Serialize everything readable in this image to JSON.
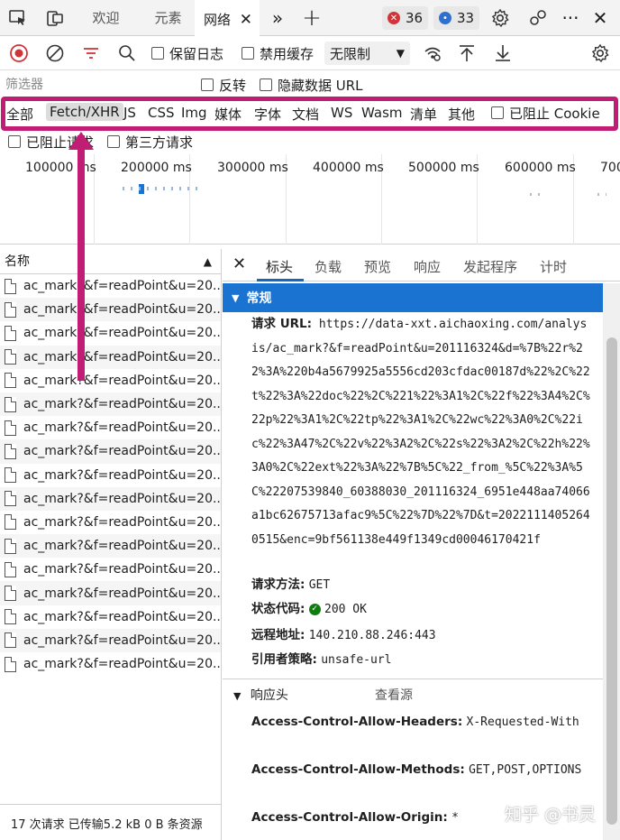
{
  "tabs": [
    {
      "label": "欢迎"
    },
    {
      "label": "元素"
    },
    {
      "label": "网络"
    }
  ],
  "badges": {
    "errors": "36",
    "messages": "33"
  },
  "toolbar": {
    "preserve_log": "保留日志",
    "disable_cache": "禁用缓存",
    "throttle": "无限制"
  },
  "filter": {
    "placeholder": "筛选器",
    "invert": "反转",
    "hide_data_url": "隐藏数据 URL"
  },
  "types": [
    "全部",
    "Fetch/XHR",
    "JS",
    "CSS",
    "Img",
    "媒体",
    "字体",
    "文档",
    "WS",
    "Wasm",
    "清单",
    "其他"
  ],
  "blocked_cookies": "已阻止 Cookie",
  "blocked_requests": "已阻止请求",
  "third_party": "第三方请求",
  "timeline_ticks": [
    "100000 ms",
    "200000 ms",
    "300000 ms",
    "400000 ms",
    "500000 ms",
    "600000 ms",
    "700"
  ],
  "list": {
    "header": "名称",
    "rows": [
      "ac_mark?&f=readPoint&u=20...",
      "ac_mark?&f=readPoint&u=20...",
      "ac_mark?&f=readPoint&u=20...",
      "ac_mark?&f=readPoint&u=20...",
      "ac_mark?&f=readPoint&u=20...",
      "ac_mark?&f=readPoint&u=20...",
      "ac_mark?&f=readPoint&u=20...",
      "ac_mark?&f=readPoint&u=20...",
      "ac_mark?&f=readPoint&u=20...",
      "ac_mark?&f=readPoint&u=20...",
      "ac_mark?&f=readPoint&u=20...",
      "ac_mark?&f=readPoint&u=20...",
      "ac_mark?&f=readPoint&u=20...",
      "ac_mark?&f=readPoint&u=20...",
      "ac_mark?&f=readPoint&u=20...",
      "ac_mark?&f=readPoint&u=20...",
      "ac_mark?&f=readPoint&u=20..."
    ],
    "status": "17 次请求  已传输5.2 kB  0 B 条资源"
  },
  "detail": {
    "tabs": [
      "标头",
      "负载",
      "预览",
      "响应",
      "发起程序",
      "计时"
    ],
    "general_title": "常规",
    "request_url_label": "请求 URL:",
    "request_url": "https://data-xxt.aichaoxing.com/analysis/ac_mark?&f=readPoint&u=201116324&d=%7B%22r%22%3A%220b4a5679925a5556cd203cfdac00187d%22%2C%22t%22%3A%22doc%22%2C%221%22%3A1%2C%22f%22%3A4%2C%22p%22%3A1%2C%22tp%22%3A1%2C%22wc%22%3A0%2C%22ic%22%3A47%2C%22v%22%3A2%2C%22s%22%3A2%2C%22h%22%3A0%2C%22ext%22%3A%22%7B%5C%22_from_%5C%22%3A%5C%22207539840_60388030_201116324_6951e448aa74066a1bc62675713afac9%5C%22%7D%22%7D&t=20221114052640515&enc=9bf561138e449f1349cd00046170421f",
    "method_label": "请求方法:",
    "method": "GET",
    "status_label": "状态代码:",
    "status": "200 OK",
    "remote_label": "远程地址:",
    "remote": "140.210.88.246:443",
    "referrer_label": "引用者策略:",
    "referrer": "unsafe-url",
    "response_headers_title": "响应头",
    "view_source": "查看源",
    "headers": [
      {
        "k": "Access-Control-Allow-Headers:",
        "v": "X-Requested-With"
      },
      {
        "k": "Access-Control-Allow-Methods:",
        "v": "GET,POST,OPTIONS"
      },
      {
        "k": "Access-Control-Allow-Origin:",
        "v": "*"
      }
    ]
  },
  "watermark": "知乎 @书灵",
  "colors": {
    "accent": "#1a73d1",
    "annotation": "#c21d74",
    "error": "#d13438",
    "message": "#2f6fd1",
    "ok": "#107c10"
  }
}
